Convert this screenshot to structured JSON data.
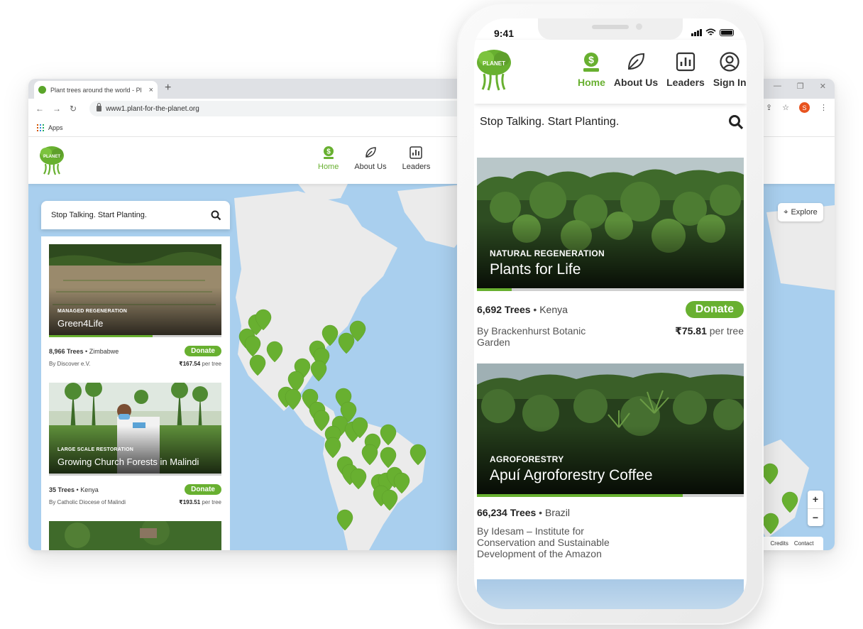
{
  "browser": {
    "tab_title": "Plant trees around the world - Pl",
    "tab_close": "×",
    "new_tab": "+",
    "url": "www1.plant-for-the-planet.org",
    "bookmark_apps": "Apps",
    "profile_initial": "S",
    "nav_icons": [
      "arrow-left-icon",
      "arrow-right-icon",
      "reload-icon",
      "lock-icon"
    ],
    "window_controls": [
      "minimize-icon",
      "maximize-icon",
      "close-icon"
    ]
  },
  "site": {
    "brand_color": "#68b030",
    "nav": [
      {
        "label": "Home",
        "icon": "donate-icon",
        "active": true
      },
      {
        "label": "About Us",
        "icon": "leaf-icon",
        "active": false
      },
      {
        "label": "Leaders",
        "icon": "chart-icon",
        "active": false
      }
    ],
    "search_placeholder": "Stop Talking. Start Planting.",
    "explore_label": "Explore",
    "zoom_in": "+",
    "zoom_out": "−",
    "footer_links": [
      "Credits",
      "Contact"
    ],
    "projects": [
      {
        "type": "MANAGED REGENERATION",
        "name": "Green4Life",
        "trees": "8,966 Trees",
        "country": "Zimbabwe",
        "by": "By Discover e.V.",
        "price": "₹167.54",
        "per": "per tree",
        "donate": "Donate",
        "progress": 0.6
      },
      {
        "type": "LARGE SCALE RESTORATION",
        "name": "Growing Church Forests in Malindi",
        "trees": "35 Trees",
        "country": "Kenya",
        "by": "By Catholic Diocese of Malindi",
        "price": "₹193.51",
        "per": "per tree",
        "donate": "Donate",
        "progress": 0.0
      }
    ]
  },
  "phone": {
    "time": "9:41",
    "nav": [
      {
        "label": "Home",
        "icon": "donate-icon",
        "active": true
      },
      {
        "label": "About Us",
        "icon": "leaf-icon",
        "active": false
      },
      {
        "label": "Leaders",
        "icon": "chart-icon",
        "active": false
      },
      {
        "label": "Sign In",
        "icon": "user-icon",
        "active": false
      }
    ],
    "search_placeholder": "Stop Talking. Start Planting.",
    "projects": [
      {
        "type": "NATURAL REGENERATION",
        "name": "Plants for Life",
        "trees": "6,692 Trees",
        "country": "Kenya",
        "by": "By Brackenhurst Botanic Garden",
        "price": "₹75.81",
        "per": "per tree",
        "donate": "Donate",
        "progress": 0.13
      },
      {
        "type": "AGROFORESTRY",
        "name": "Apuí Agroforestry Coffee",
        "trees": "66,234 Trees",
        "country": "Brazil",
        "by": "By Idesam – Institute for Conservation and Sustainable Development of the Amazon",
        "progress": 0.77
      }
    ]
  }
}
